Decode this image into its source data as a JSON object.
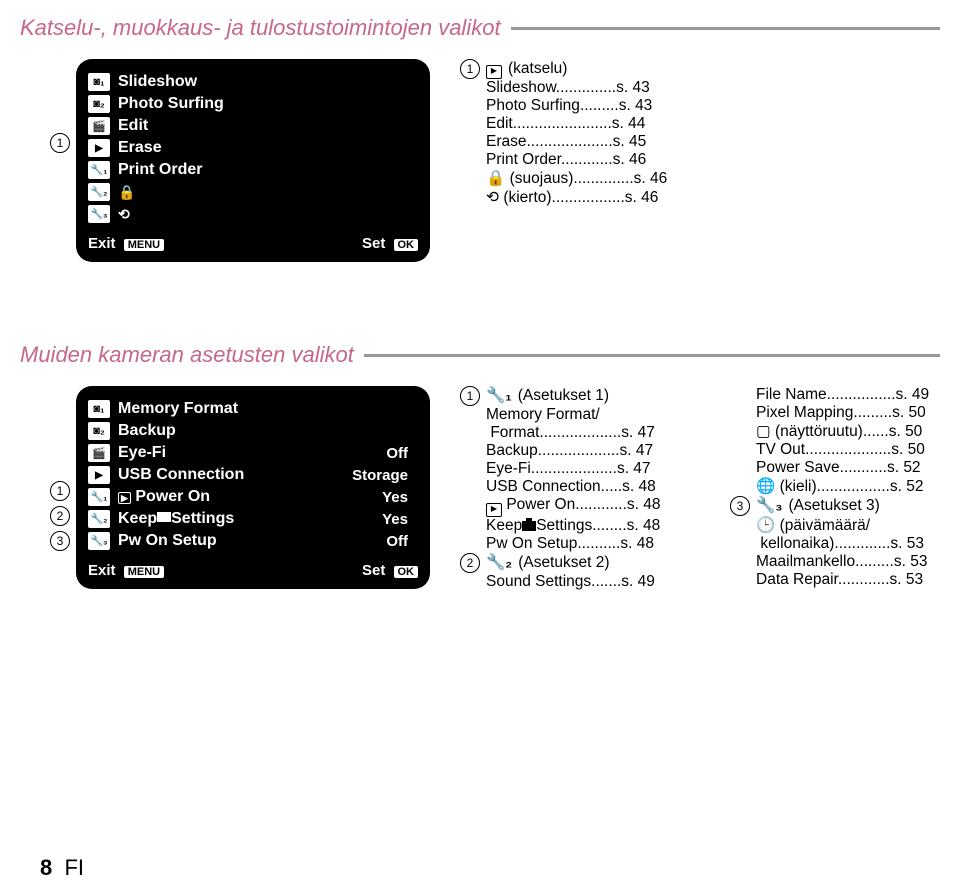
{
  "section1": {
    "title": "Katselu-, muokkaus- ja tulostustoimintojen valikot",
    "ref_num": "1",
    "menu": {
      "items": [
        {
          "icon": "camera1",
          "label": "Slideshow"
        },
        {
          "icon": "camera2",
          "label": "Photo Surfing"
        },
        {
          "icon": "film",
          "label": "Edit"
        },
        {
          "icon": "play",
          "label": "Erase"
        },
        {
          "icon": "tool1",
          "label": "Print Order"
        },
        {
          "icon": "tool2",
          "label": ""
        },
        {
          "icon": "tool3",
          "label": ""
        }
      ],
      "exit_label": "Exit",
      "exit_btn": "MENU",
      "set_label": "Set",
      "set_btn": "OK"
    },
    "refs": {
      "header_icon": "play",
      "header_text": "(katselu)",
      "lines": [
        {
          "label": "Slideshow",
          "page": "s. 43"
        },
        {
          "label": "Photo Surfing",
          "page": "s. 43"
        },
        {
          "label": "Edit",
          "page": "s. 44"
        },
        {
          "label": "Erase",
          "page": "s. 45"
        },
        {
          "label": "Print Order",
          "page": "s. 46"
        },
        {
          "label_icon": "shield",
          "label": "(suojaus)",
          "page": "s. 46"
        },
        {
          "label_icon": "rotate",
          "label": "(kierto)",
          "page": "s. 46"
        }
      ]
    }
  },
  "section2": {
    "title": "Muiden kameran asetusten valikot",
    "menu": {
      "items": [
        {
          "icon": "camera1",
          "label": "Memory Format",
          "value": ""
        },
        {
          "icon": "camera2",
          "label": "Backup",
          "value": ""
        },
        {
          "icon": "film",
          "label": "Eye-Fi",
          "value": "Off"
        },
        {
          "icon": "play",
          "label": "USB Connection",
          "value": "Storage"
        },
        {
          "icon": "tool1",
          "label_pre_icon": "play-small",
          "label": "Power On",
          "value": "Yes"
        },
        {
          "icon": "tool2",
          "label": "Keep",
          "label_inline_icon": "camera",
          "label_suffix": "Settings",
          "value": "Yes"
        },
        {
          "icon": "tool3",
          "label": "Pw On Setup",
          "value": "Off"
        }
      ],
      "exit_label": "Exit",
      "exit_btn": "MENU",
      "set_label": "Set",
      "set_btn": "OK"
    },
    "col1": {
      "heading_num": "1",
      "heading_text": "(Asetukset 1)",
      "sub1": "Memory Format/",
      "lines1": [
        {
          "label": "Format",
          "page": "s. 47"
        },
        {
          "label": "Backup",
          "page": "s. 47"
        },
        {
          "label": "Eye-Fi",
          "page": "s. 47"
        },
        {
          "label": "USB Connection",
          "page": "s. 48"
        },
        {
          "label_icon": "play-small",
          "label": "Power On",
          "page": "s. 48"
        },
        {
          "label": "Keep",
          "label_inline_icon": "camera",
          "label_suffix": "Settings",
          "page": "s. 48"
        },
        {
          "label": "Pw On Setup",
          "page": "s. 48"
        }
      ],
      "heading_num2": "2",
      "heading_text2": "(Asetukset 2)",
      "lines2": [
        {
          "label": "Sound Settings",
          "page": "s. 49"
        }
      ]
    },
    "col2": {
      "lines_top": [
        {
          "label": "File Name",
          "page": "s. 49"
        },
        {
          "label": "Pixel Mapping",
          "page": "s. 50"
        },
        {
          "label_icon": "screen",
          "label": "(näyttöruutu)",
          "page": "s. 50"
        },
        {
          "label": "TV Out",
          "page": "s. 50"
        },
        {
          "label": "Power Save",
          "page": "s. 52"
        },
        {
          "label_icon": "globe",
          "label": "(kieli)",
          "page": "s. 52"
        }
      ],
      "heading_num": "3",
      "heading_text": "(Asetukset 3)",
      "sub": "(päivämäärä/",
      "lines": [
        {
          "label": "kellonaika)",
          "page": "s. 53"
        },
        {
          "label": "Maailmankello",
          "page": "s. 53"
        },
        {
          "label": "Data Repair",
          "page": "s. 53"
        }
      ]
    }
  },
  "footer": {
    "page_num": "8",
    "lang": "FI"
  }
}
